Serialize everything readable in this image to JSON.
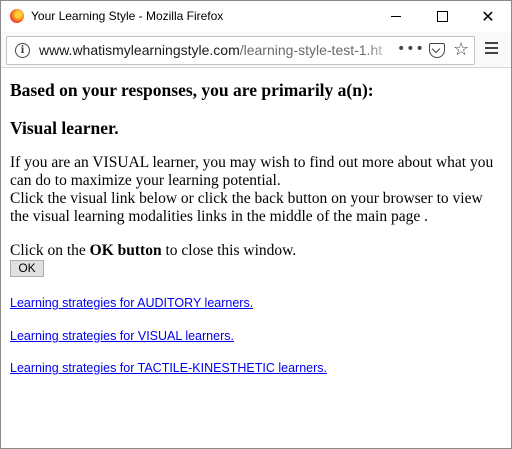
{
  "window": {
    "title": "Your Learning Style - Mozilla Firefox"
  },
  "urlbar": {
    "url_domain": "www.whatismylearningstyle.com",
    "url_path": "/learning-style-test-1.ht",
    "overflow_label": "•••"
  },
  "content": {
    "heading": "Based on your responses, you are primarily a(n):",
    "result": "Visual learner.",
    "para_line1": "If you are an VISUAL learner, you may wish to find out more about what you can do to maximize your learning potential.",
    "para_line2": "Click the visual link below or click the back button on your browser to view the visual learning modalities links in the middle of the main page .",
    "close_prefix": "Click on the ",
    "close_bold": "OK button",
    "close_suffix": " to close this window.",
    "ok_label": "OK",
    "links": [
      "Learning strategies for AUDITORY learners.",
      "Learning strategies for VISUAL learners.",
      "Learning strategies for TACTILE-KINESTHETIC learners."
    ]
  },
  "icons": {
    "app": "firefox-logo-icon",
    "info": "info-icon",
    "pocket": "pocket-icon",
    "bookmark": "star-icon",
    "menu": "hamburger-menu-icon"
  }
}
